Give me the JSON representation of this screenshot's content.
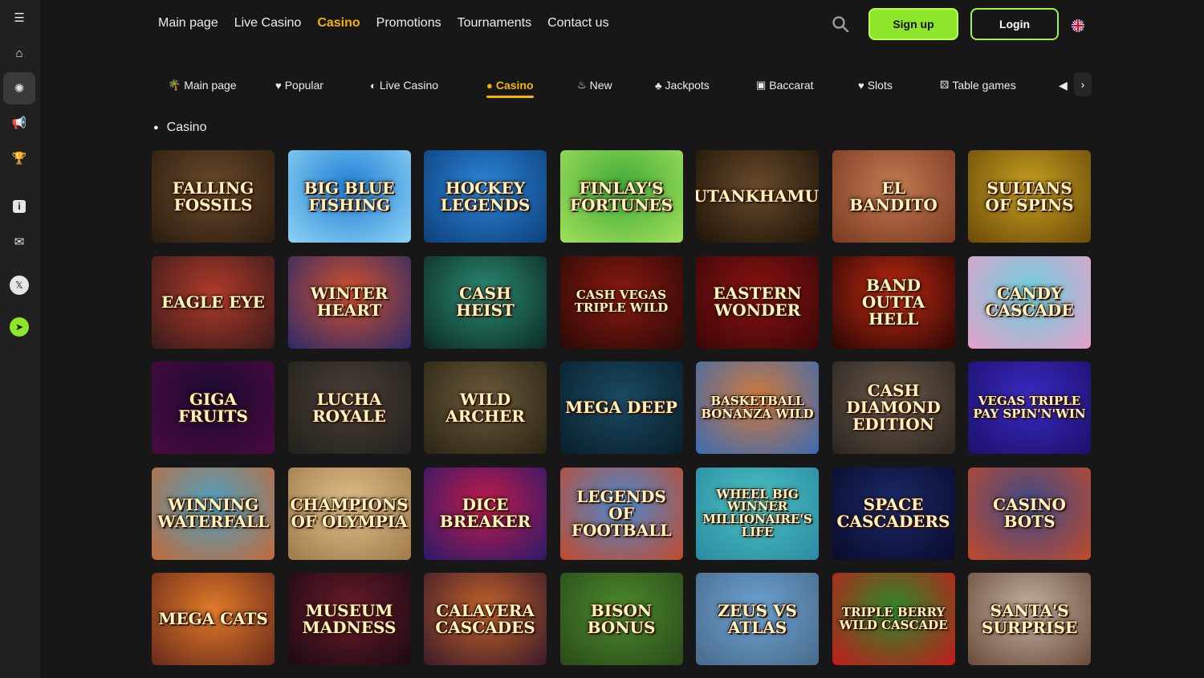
{
  "nav": {
    "links": [
      "Main page",
      "Live Casino",
      "Casino",
      "Promotions",
      "Tournaments",
      "Contact us"
    ],
    "active": "Casino"
  },
  "header": {
    "signup": "Sign up",
    "login": "Login"
  },
  "categories": [
    {
      "label": "Main page",
      "icon": "palm-icon",
      "glyph": "🌴"
    },
    {
      "label": "Popular",
      "icon": "shield-heart-icon",
      "glyph": "♥"
    },
    {
      "label": "Live Casino",
      "icon": "live-icon",
      "glyph": "◐"
    },
    {
      "label": "Casino",
      "icon": "casino-chip-icon",
      "glyph": "●"
    },
    {
      "label": "New",
      "icon": "flame-icon",
      "glyph": "♨"
    },
    {
      "label": "Jackpots",
      "icon": "jackpot-icon",
      "glyph": "♣"
    },
    {
      "label": "Baccarat",
      "icon": "cards-icon",
      "glyph": "▣"
    },
    {
      "label": "Slots",
      "icon": "heart-icon",
      "glyph": "♥"
    },
    {
      "label": "Table games",
      "icon": "dice-icon",
      "glyph": "⚄"
    }
  ],
  "section": {
    "title": "Casino"
  },
  "games": [
    {
      "title": "Falling Fossils",
      "bg": "#6b4a2a",
      "bg2": "#2a1c10"
    },
    {
      "title": "Big Blue Fishing",
      "bg": "#1f7fd4",
      "bg2": "#8fd3f5"
    },
    {
      "title": "Hockey Legends",
      "bg": "#2a86d9",
      "bg2": "#0e3e7a"
    },
    {
      "title": "Finlay's Fortunes",
      "bg": "#3faa3a",
      "bg2": "#a2e05a"
    },
    {
      "title": "Tutankhamun",
      "bg": "#6a4a2a",
      "bg2": "#1c1408"
    },
    {
      "title": "El Bandito",
      "bg": "#c27a52",
      "bg2": "#7a3a20"
    },
    {
      "title": "Sultans of Spins",
      "bg": "#c6a020",
      "bg2": "#6a4a08"
    },
    {
      "title": "Eagle Eye",
      "bg": "#b03a2a",
      "bg2": "#3a1a1a"
    },
    {
      "title": "Winter Heart",
      "bg": "#d2502a",
      "bg2": "#2a2a6a"
    },
    {
      "title": "Cash Heist",
      "bg": "#2a8a72",
      "bg2": "#0c2a24"
    },
    {
      "title": "Cash Vegas Triple Wild",
      "bg": "#8a1a10",
      "bg2": "#2a0806"
    },
    {
      "title": "Eastern Wonder",
      "bg": "#8a1212",
      "bg2": "#3a0606"
    },
    {
      "title": "Band outta Hell",
      "bg": "#c02a12",
      "bg2": "#2a0604"
    },
    {
      "title": "Candy Cascade",
      "bg": "#6ad0e0",
      "bg2": "#e8a0c8"
    },
    {
      "title": "Giga Fruits",
      "bg": "#1a0a30",
      "bg2": "#4a0a40"
    },
    {
      "title": "Lucha Royale",
      "bg": "#4a3e36",
      "bg2": "#22201c"
    },
    {
      "title": "Wild Archer",
      "bg": "#6a5a3a",
      "bg2": "#2a2414"
    },
    {
      "title": "Mega Deep",
      "bg": "#1a4a62",
      "bg2": "#081e2a"
    },
    {
      "title": "Basketball Bonanza Wild",
      "bg": "#d27a3a",
      "bg2": "#3a6ab2"
    },
    {
      "title": "Cash Diamond Edition",
      "bg": "#6a5a4a",
      "bg2": "#2a2420"
    },
    {
      "title": "Vegas Triple Pay Spin'n'Win",
      "bg": "#3a2ac2",
      "bg2": "#1a106a"
    },
    {
      "title": "Winning Waterfall",
      "bg": "#4aa2c2",
      "bg2": "#c26a3a"
    },
    {
      "title": "Champions of Olympia",
      "bg": "#e0c08a",
      "bg2": "#a07a4a"
    },
    {
      "title": "Dice Breaker",
      "bg": "#c21a4a",
      "bg2": "#2a1a6a"
    },
    {
      "title": "Legends of Football",
      "bg": "#4a8ad2",
      "bg2": "#c24a2a"
    },
    {
      "title": "Wheel Big Winner Millionaire's Life",
      "bg": "#4ac2c2",
      "bg2": "#2a8aa2"
    },
    {
      "title": "Space Cascaders",
      "bg": "#1a2a6a",
      "bg2": "#0a0a2a"
    },
    {
      "title": "Casino Bots",
      "bg": "#3a4a8a",
      "bg2": "#c24a2a"
    },
    {
      "title": "Mega Cats",
      "bg": "#e07a2a",
      "bg2": "#6a2a1a"
    },
    {
      "title": "Museum Madness",
      "bg": "#6a1a2a",
      "bg2": "#1a0a10"
    },
    {
      "title": "Calavera Cascades",
      "bg": "#c2622a",
      "bg2": "#3a1a2a"
    },
    {
      "title": "Bison Bonus",
      "bg": "#4a8a2a",
      "bg2": "#2a4a1a"
    },
    {
      "title": "Zeus vs Atlas",
      "bg": "#6aa2d2",
      "bg2": "#4a6a8a"
    },
    {
      "title": "Triple Berry Wild Cascade",
      "bg": "#2a8a2a",
      "bg2": "#c21a1a"
    },
    {
      "title": "Santa's Surprise",
      "bg": "#c2b2a2",
      "bg2": "#6a4a3a"
    }
  ],
  "sidebar": {
    "items": [
      {
        "name": "menu-toggle-icon",
        "glyph": "☰"
      },
      {
        "name": "home-icon",
        "glyph": "⌂"
      },
      {
        "name": "casino-chip-icon",
        "glyph": "✺"
      },
      {
        "name": "megaphone-icon",
        "glyph": "📢"
      },
      {
        "name": "trophy-icon",
        "glyph": "🏆"
      },
      {
        "name": "info-icon",
        "glyph": "i"
      },
      {
        "name": "chat-icon",
        "glyph": "✉"
      },
      {
        "name": "x-twitter-icon",
        "glyph": "𝕏"
      },
      {
        "name": "telegram-icon",
        "glyph": "➤"
      }
    ]
  },
  "colors": {
    "accent": "#f5b400",
    "signup": "#8ee62a",
    "bg": "#171717",
    "sidebar": "#202020"
  }
}
